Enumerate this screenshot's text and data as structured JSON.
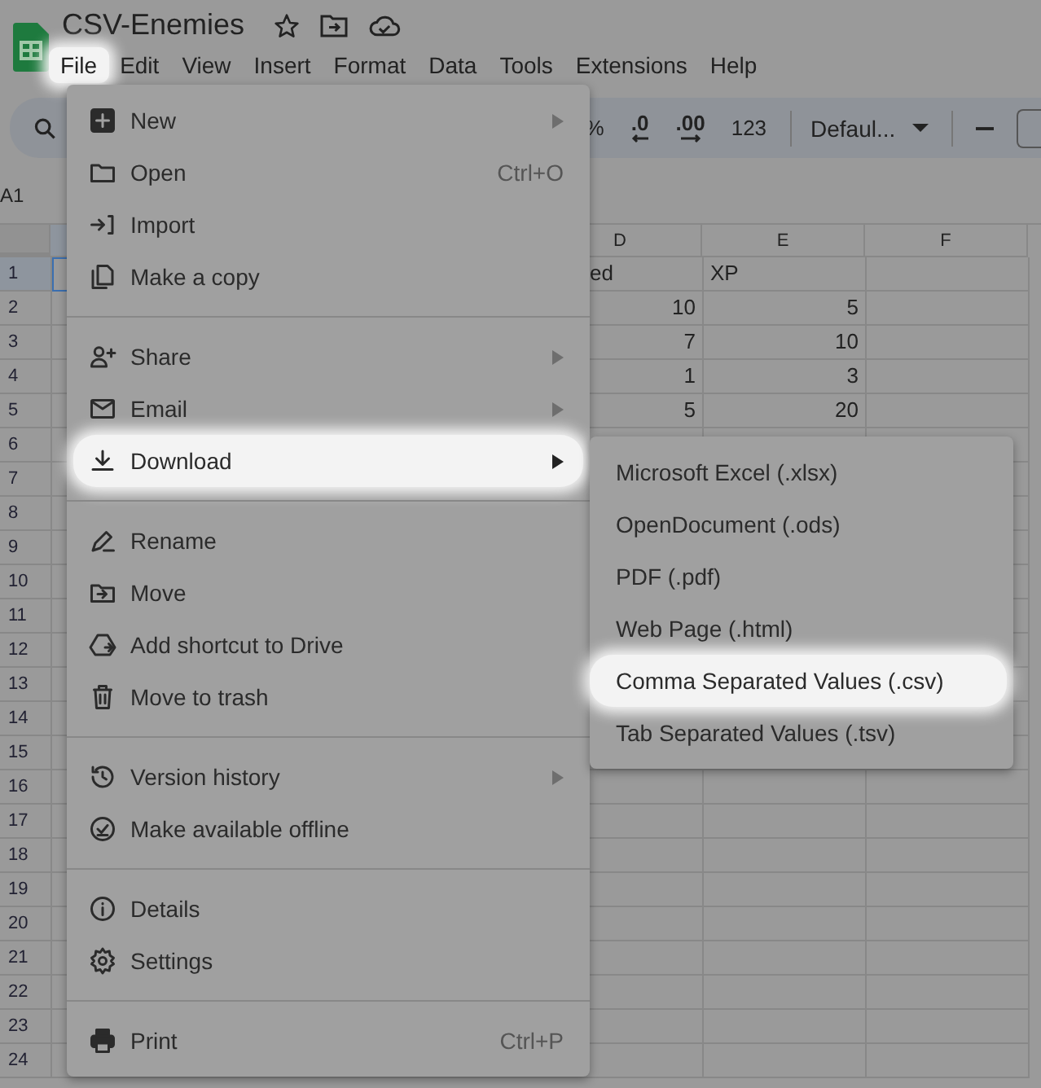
{
  "document": {
    "title": "CSV-Enemies"
  },
  "menubar": [
    {
      "label": "File",
      "selected": true
    },
    {
      "label": "Edit",
      "selected": false
    },
    {
      "label": "View",
      "selected": false
    },
    {
      "label": "Insert",
      "selected": false
    },
    {
      "label": "Format",
      "selected": false
    },
    {
      "label": "Data",
      "selected": false
    },
    {
      "label": "Tools",
      "selected": false
    },
    {
      "label": "Extensions",
      "selected": false
    },
    {
      "label": "Help",
      "selected": false
    }
  ],
  "toolbar": [
    {
      "kind": "text",
      "label": "%"
    },
    {
      "kind": "decimal_less",
      "label": ".0"
    },
    {
      "kind": "decimal_more",
      "label": ".00"
    },
    {
      "kind": "text",
      "label": "123"
    },
    {
      "kind": "separator"
    },
    {
      "kind": "dropdown",
      "label": "Defaul..."
    },
    {
      "kind": "separator"
    },
    {
      "kind": "minus"
    },
    {
      "kind": "box"
    }
  ],
  "name_box": "A1",
  "sheet": {
    "columns": [
      "D",
      "E",
      "F"
    ],
    "rows": [
      {
        "number": "1",
        "selected": true,
        "cells": [
          {
            "text": "ed",
            "numeric": false
          },
          {
            "text": "XP",
            "numeric": false
          }
        ]
      },
      {
        "number": "2",
        "selected": false,
        "cells": [
          {
            "text": "10",
            "numeric": true
          },
          {
            "text": "5",
            "numeric": true
          }
        ]
      },
      {
        "number": "3",
        "selected": false,
        "cells": [
          {
            "text": "7",
            "numeric": true
          },
          {
            "text": "10",
            "numeric": true
          }
        ]
      },
      {
        "number": "4",
        "selected": false,
        "cells": [
          {
            "text": "1",
            "numeric": true
          },
          {
            "text": "3",
            "numeric": true
          }
        ]
      },
      {
        "number": "5",
        "selected": false,
        "cells": [
          {
            "text": "5",
            "numeric": true
          },
          {
            "text": "20",
            "numeric": true
          }
        ]
      },
      {
        "number": "6",
        "selected": false,
        "cells": []
      },
      {
        "number": "7",
        "selected": false,
        "cells": []
      },
      {
        "number": "8",
        "selected": false,
        "cells": []
      },
      {
        "number": "9",
        "selected": false,
        "cells": []
      },
      {
        "number": "10",
        "selected": false,
        "cells": []
      },
      {
        "number": "11",
        "selected": false,
        "cells": []
      },
      {
        "number": "12",
        "selected": false,
        "cells": []
      },
      {
        "number": "13",
        "selected": false,
        "cells": []
      },
      {
        "number": "14",
        "selected": false,
        "cells": []
      },
      {
        "number": "15",
        "selected": false,
        "cells": []
      },
      {
        "number": "16",
        "selected": false,
        "cells": []
      },
      {
        "number": "17",
        "selected": false,
        "cells": []
      },
      {
        "number": "18",
        "selected": false,
        "cells": []
      },
      {
        "number": "19",
        "selected": false,
        "cells": []
      },
      {
        "number": "20",
        "selected": false,
        "cells": []
      },
      {
        "number": "21",
        "selected": false,
        "cells": []
      },
      {
        "number": "22",
        "selected": false,
        "cells": []
      },
      {
        "number": "23",
        "selected": false,
        "cells": []
      },
      {
        "number": "24",
        "selected": false,
        "cells": []
      }
    ]
  },
  "file_menu": {
    "sections": [
      [
        {
          "kind": "plus",
          "label": "New",
          "submenu": true,
          "selected": false
        },
        {
          "kind": "folder",
          "label": "Open",
          "shortcut": "Ctrl+O",
          "submenu": false,
          "selected": false
        },
        {
          "kind": "import",
          "label": "Import",
          "submenu": false,
          "selected": false
        },
        {
          "kind": "copy",
          "label": "Make a copy",
          "submenu": false,
          "selected": false
        }
      ],
      [
        {
          "kind": "person",
          "label": "Share",
          "submenu": true,
          "selected": false
        },
        {
          "kind": "mail",
          "label": "Email",
          "submenu": true,
          "selected": false
        },
        {
          "kind": "download",
          "label": "Download",
          "submenu": true,
          "selected": true
        }
      ],
      [
        {
          "kind": "pencil",
          "label": "Rename",
          "submenu": false,
          "selected": false
        },
        {
          "kind": "move",
          "label": "Move",
          "submenu": false,
          "selected": false
        },
        {
          "kind": "drive",
          "label": "Add shortcut to Drive",
          "submenu": false,
          "selected": false
        },
        {
          "kind": "trash",
          "label": "Move to trash",
          "submenu": false,
          "selected": false
        }
      ],
      [
        {
          "kind": "history",
          "label": "Version history",
          "submenu": true,
          "selected": false
        },
        {
          "kind": "offline",
          "label": "Make available offline",
          "submenu": false,
          "selected": false
        }
      ],
      [
        {
          "kind": "info",
          "label": "Details",
          "submenu": false,
          "selected": false
        },
        {
          "kind": "gear",
          "label": "Settings",
          "submenu": false,
          "selected": false
        }
      ],
      [
        {
          "kind": "printer",
          "label": "Print",
          "shortcut": "Ctrl+P",
          "submenu": false,
          "selected": false
        }
      ]
    ]
  },
  "download_submenu": [
    {
      "label": "Microsoft Excel (.xlsx)",
      "selected": false
    },
    {
      "label": "OpenDocument (.ods)",
      "selected": false
    },
    {
      "label": "PDF (.pdf)",
      "selected": false
    },
    {
      "label": "Web Page (.html)",
      "selected": false
    },
    {
      "label": "Comma Separated Values (.csv)",
      "selected": true
    },
    {
      "label": "Tab Separated Values (.tsv)",
      "selected": false
    }
  ]
}
